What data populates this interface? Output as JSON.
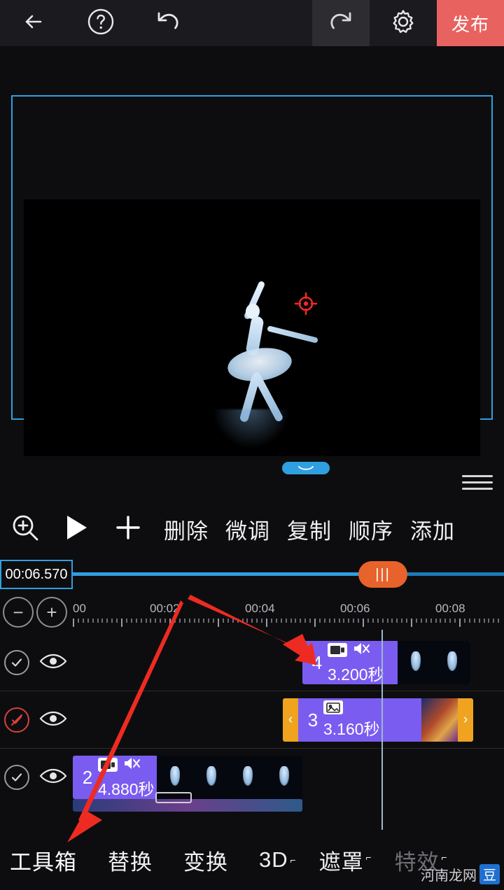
{
  "topbar": {
    "back_icon": "arrow-left-icon",
    "help_icon": "question-circle-icon",
    "undo_icon": "undo-icon",
    "redo_icon": "redo-icon",
    "settings_icon": "gear-icon",
    "publish_label": "发布"
  },
  "preview": {
    "target_icon": "crosshair-icon",
    "handle_icon": "drag-handle-icon",
    "menu_icon": "hamburger-icon"
  },
  "toolrow": {
    "zoom_icon": "zoom-in-icon",
    "play_icon": "play-icon",
    "add_icon": "plus-icon",
    "items": [
      {
        "label": "删除"
      },
      {
        "label": "微调"
      },
      {
        "label": "复制"
      },
      {
        "label": "顺序"
      },
      {
        "label": "添加"
      }
    ]
  },
  "timeline": {
    "current_time": "00:06.570",
    "scrub_knob_label": "|||",
    "zoom_out_label": "−",
    "zoom_in_label": "+",
    "ruler_ticks": [
      "00",
      "00:02",
      "00:04",
      "00:06",
      "00:08"
    ],
    "tracks": [
      {
        "check_icon": "check-circle-icon",
        "check_state": "on",
        "eye_icon": "eye-icon",
        "clip": {
          "number": "4",
          "duration": "3.200秒",
          "icons": [
            "film-strip-icon",
            "mute-icon"
          ],
          "left_handle": "",
          "right_handle": ""
        }
      },
      {
        "check_icon": "check-circle-icon",
        "check_state": "off",
        "eye_icon": "eye-icon",
        "clip": {
          "number": "3",
          "duration": "3.160秒",
          "icons": [
            "image-icon"
          ],
          "left_handle": "‹",
          "right_handle": "›"
        }
      },
      {
        "check_icon": "check-circle-icon",
        "check_state": "on",
        "eye_icon": "eye-icon",
        "clip": {
          "number": "2",
          "duration": "4.880秒",
          "icons": [
            "film-strip-icon",
            "mute-icon"
          ],
          "left_handle": "",
          "right_handle": ""
        }
      }
    ]
  },
  "bottombar": {
    "items": [
      {
        "label": "工具箱",
        "sup": "",
        "dim": false
      },
      {
        "label": "替换",
        "sup": "",
        "dim": false
      },
      {
        "label": "变换",
        "sup": "",
        "dim": false
      },
      {
        "label": "3D",
        "sup": "⌐",
        "dim": false
      },
      {
        "label": "遮罩",
        "sup": "⌐",
        "dim": false
      },
      {
        "label": "特效",
        "sup": "⌐",
        "dim": true
      }
    ]
  },
  "watermark": {
    "text": "河南龙网",
    "chip": "豆"
  },
  "colors": {
    "accent_blue": "#2f9fe0",
    "publish_red": "#e8635f",
    "clip_purple": "#7b5cf0",
    "handle_orange": "#f0a31e",
    "scrub_orange": "#e8622b",
    "annotation_red": "#ee2b22"
  }
}
